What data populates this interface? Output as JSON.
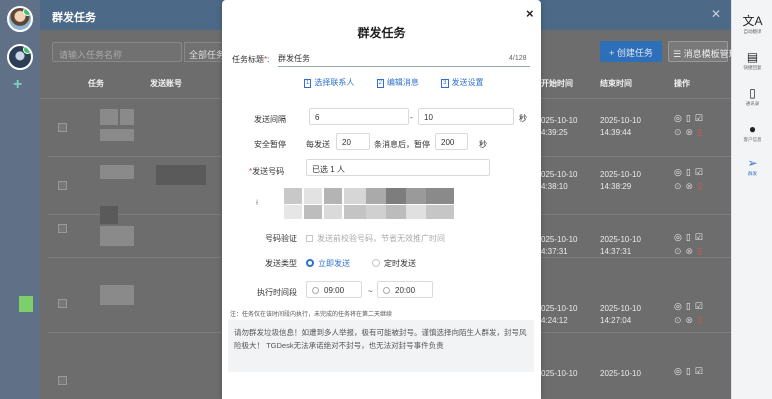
{
  "sidebar": {
    "icons": [
      "avatar-user",
      "avatar-account",
      "plus-icon"
    ],
    "badges": [
      "6",
      "3"
    ]
  },
  "backdrop": {
    "title": "群发任务",
    "search_placeholder": "请输入任务名称",
    "filter_label": "全部任务",
    "create_button": "+ 创建任务",
    "template_button": "消息模板管理",
    "columns": [
      "任务",
      "发送账号",
      "开始时间",
      "结束时间",
      "操作"
    ],
    "rows": [
      {
        "start_date": "025-10-10",
        "start_time": "4:39:25",
        "end_date": "2025-10-10",
        "end_time": "14:39:44"
      },
      {
        "start_date": "025-10-10",
        "start_time": "4:38:10",
        "end_date": "2025-10-10",
        "end_time": "14:38:29"
      },
      {
        "start_date": "025-10-10",
        "start_time": "4:37:31",
        "end_date": "2025-10-10",
        "end_time": "14:37:31"
      },
      {
        "start_date": "025-10-10",
        "start_time": "4:24:12",
        "end_date": "2025-10-10",
        "end_time": "14:27:04"
      },
      {
        "start_date": "025-10-10",
        "start_time": "",
        "end_date": "2025-10-10",
        "end_time": ""
      }
    ]
  },
  "right_rail": [
    {
      "icon": "translate-icon",
      "glyph": "文A",
      "label": "自动翻译"
    },
    {
      "icon": "quick-reply-icon",
      "glyph": "▤",
      "label": "快捷回复"
    },
    {
      "icon": "notes-icon",
      "glyph": "▯",
      "label": "通讯录"
    },
    {
      "icon": "user-icon",
      "glyph": "●",
      "label": "客户信息"
    },
    {
      "icon": "send-icon",
      "glyph": "➢",
      "label": "群发"
    }
  ],
  "modal": {
    "title": "群发任务",
    "close": "×",
    "task_title_label": "任务标题",
    "task_title_value": "群发任务",
    "char_count": "4/128",
    "steps": [
      {
        "num": "1",
        "label": "选择联系人"
      },
      {
        "num": "2",
        "label": "编辑消息"
      },
      {
        "num": "3",
        "label": "发送设置"
      }
    ],
    "interval_label": "发送间隔",
    "interval_min": "6",
    "interval_sep": "-",
    "interval_max": "10",
    "interval_unit": "秒",
    "pause_label": "安全暂停",
    "pause_every": "每发送",
    "pause_count": "20",
    "pause_after": "条消息后，暂停",
    "pause_seconds": "200",
    "pause_unit": "秒",
    "sender_label": "发送号码",
    "sender_value": "已选 1 人",
    "verify_label": "号码验证",
    "verify_text": "发送前校验号码，节省无效推广时间",
    "type_label": "发送类型",
    "type_options": [
      "立即发送",
      "定时发送"
    ],
    "type_selected": "立即发送",
    "period_label": "执行时间段",
    "period_start": "09:00",
    "period_sep": "~",
    "period_end": "20:00",
    "note": "注：任务仅在该时间段内执行，未完成的任务将在第二天继续",
    "warning": "请勿群发垃圾信息！如遭到多人举报，极有可能被封号。谨慎选择向陌生人群发，封号风险极大！ TGDesk无法承诺绝对不封号，也无法对封号事件负责"
  },
  "colors": {
    "accent": "#2f6fd1",
    "header": "#4c6a87",
    "required": "#e23b3b"
  }
}
